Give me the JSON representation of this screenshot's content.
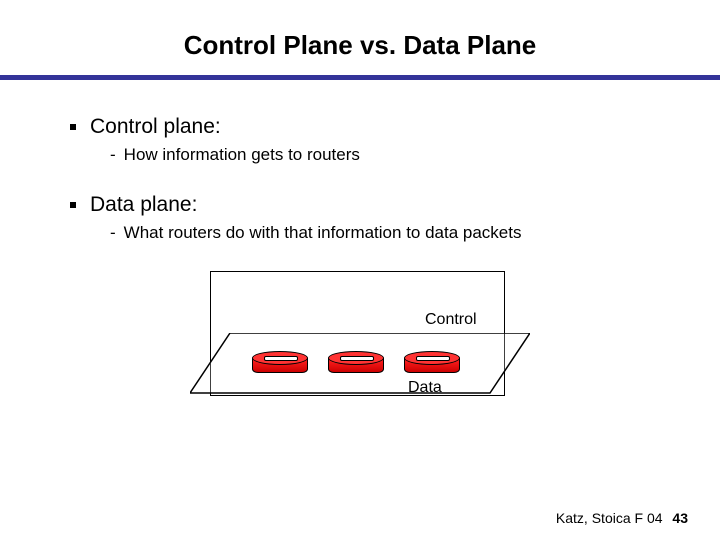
{
  "title": "Control Plane vs. Data Plane",
  "bullets": [
    {
      "heading": "Control plane:",
      "sub": "How information gets to routers"
    },
    {
      "heading": "Data plane:",
      "sub": "What routers do with that information to data packets"
    }
  ],
  "diagram": {
    "control_label": "Control",
    "data_label": "Data"
  },
  "footer": {
    "attribution": "Katz, Stoica F 04",
    "page": "43"
  }
}
